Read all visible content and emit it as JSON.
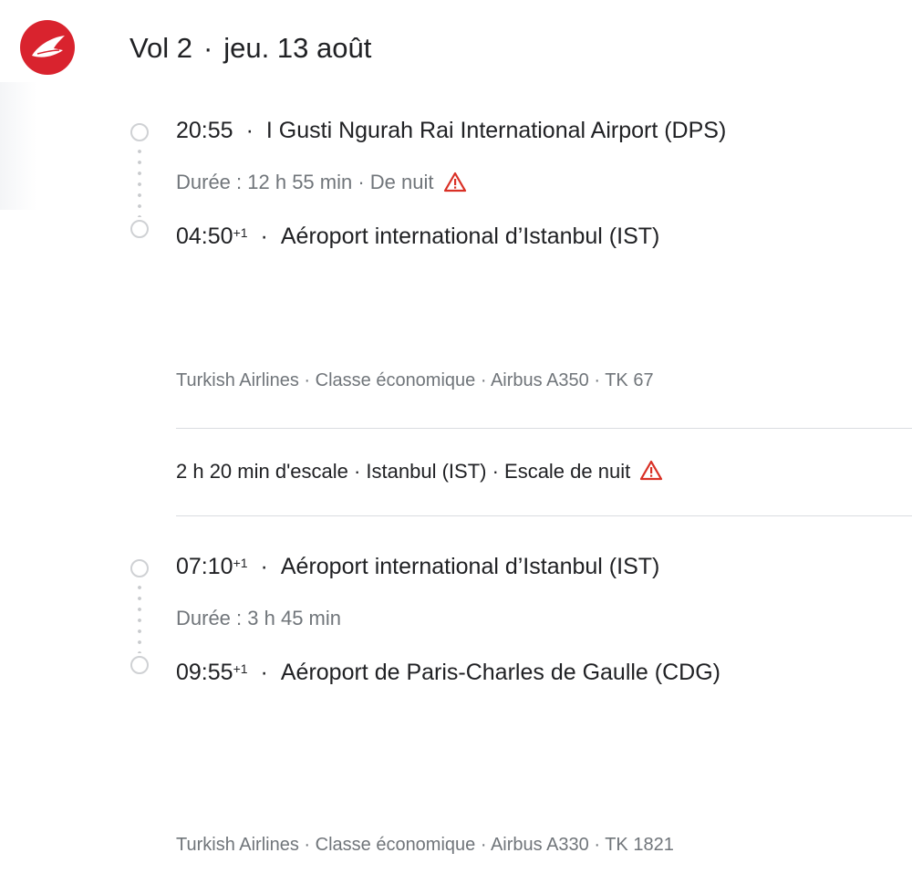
{
  "header": {
    "airline_logo": "turkish-airlines-logo",
    "flight_label": "Vol 2",
    "date": "jeu. 13 août"
  },
  "segments": [
    {
      "departure": {
        "time": "20:55",
        "plus": "",
        "airport": "I Gusti Ngurah Rai International Airport (DPS)"
      },
      "duration": "Durée : 12 h 55 min",
      "duration_note": "De nuit",
      "arrival": {
        "time": "04:50",
        "plus": "+1",
        "airport": "Aéroport international d’Istanbul (IST)"
      },
      "info": "Turkish Airlines · Classe économique · Airbus A350 · TK 67"
    },
    {
      "departure": {
        "time": "07:10",
        "plus": "+1",
        "airport": "Aéroport international d’Istanbul (IST)"
      },
      "duration": "Durée : 3 h 45 min",
      "duration_note": "",
      "arrival": {
        "time": "09:55",
        "plus": "+1",
        "airport": "Aéroport de Paris-Charles de Gaulle (CDG)"
      },
      "info": "Turkish Airlines · Classe économique · Airbus A330 · TK 1821"
    }
  ],
  "layover": {
    "text": "2 h 20 min d'escale · Istanbul (IST) · Escale de nuit"
  },
  "colors": {
    "brand_red": "#d9232e",
    "warning_red": "#d93025",
    "secondary_text": "#70757a",
    "divider": "#dadce0"
  },
  "icons": {
    "warning": "warning-triangle-icon",
    "timeline_stop": "circle-icon"
  }
}
